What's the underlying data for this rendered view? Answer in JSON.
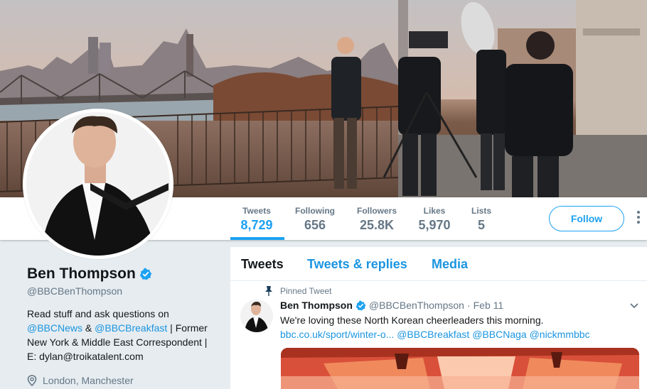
{
  "stats": [
    {
      "label": "Tweets",
      "value": "8,729"
    },
    {
      "label": "Following",
      "value": "656"
    },
    {
      "label": "Followers",
      "value": "25.8K"
    },
    {
      "label": "Likes",
      "value": "5,970"
    },
    {
      "label": "Lists",
      "value": "5"
    }
  ],
  "follow_label": "Follow",
  "profile": {
    "name": "Ben Thompson",
    "handle": "@BBCBenThompson",
    "bio_line1": "Read stuff and ask questions on",
    "bio_link1": "@BBCNews",
    "bio_amp": " & ",
    "bio_link2": "@BBCBreakfast",
    "bio_line2_rest": " | Former",
    "bio_line3": "New York & Middle East Correspondent |",
    "bio_line4": "E: dylan@troikatalent.com",
    "location": "London, Manchester"
  },
  "tabs": [
    "Tweets",
    "Tweets & replies",
    "Media"
  ],
  "pinned": {
    "label": "Pinned Tweet",
    "name": "Ben Thompson",
    "handle": "@BBCBenThompson",
    "separator": "·",
    "date": "Feb 11",
    "text": "We're loving these North Korean cheerleaders this morning.",
    "link": "bbc.co.uk/sport/winter-o...",
    "mention1": "@BBCBreakfast",
    "mention2": "@BBCNaga",
    "mention3": "@nickmmbbc"
  },
  "colors": {
    "accent": "#1da1f2",
    "link": "#1b95e0",
    "muted": "#657786"
  },
  "icons": [
    "verified-badge-icon",
    "pin-icon",
    "location-icon",
    "chevron-down-icon",
    "more-icon"
  ]
}
